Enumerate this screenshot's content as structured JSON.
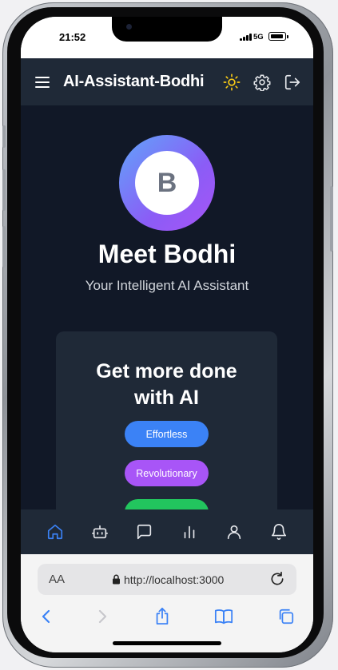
{
  "status": {
    "time": "21:52",
    "network": "5G"
  },
  "header": {
    "title": "AI-Assistant-Bodhi"
  },
  "hero": {
    "avatar_letter": "B",
    "title": "Meet Bodhi",
    "subtitle": "Your Intelligent AI Assistant"
  },
  "card": {
    "title_line1": "Get more done",
    "title_line2": "with AI",
    "pills": [
      {
        "label": "Effortless",
        "color": "#3b82f6"
      },
      {
        "label": "Revolutionary",
        "color": "#a855f7"
      },
      {
        "label": "",
        "color": "#22c55e"
      }
    ]
  },
  "bottom_nav": [
    "home-icon",
    "robot-icon",
    "chat-icon",
    "stats-icon",
    "user-icon",
    "bell-icon"
  ],
  "browser": {
    "aa_label": "AA",
    "url": "http://localhost:3000"
  },
  "colors": {
    "header_bg": "#1f2937",
    "main_bg": "#111827",
    "active_nav": "#3b82f6",
    "sun": "#facc15",
    "safari_blue": "#3b82f6"
  }
}
